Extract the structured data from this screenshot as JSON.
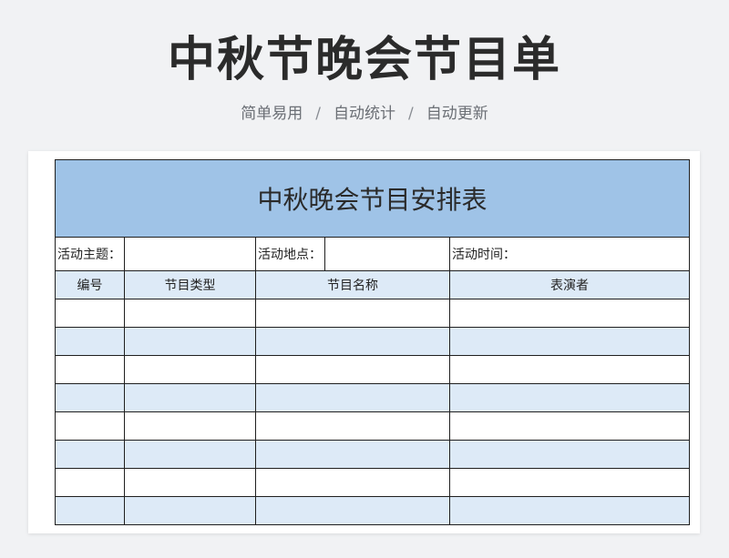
{
  "header": {
    "title": "中秋节晚会节目单",
    "features": [
      "简单易用",
      "自动统计",
      "自动更新"
    ],
    "separator": "/"
  },
  "sheet": {
    "banner_title": "中秋晚会节目安排表",
    "info": {
      "theme_label": "活动主题：",
      "theme_value": "",
      "location_label": "活动地点：",
      "location_value": "",
      "time_label": "活动时间：",
      "time_value": ""
    },
    "columns": [
      "编号",
      "节目类型",
      "节目名称",
      "表演者"
    ],
    "rows": [
      [
        "",
        "",
        "",
        ""
      ],
      [
        "",
        "",
        "",
        ""
      ],
      [
        "",
        "",
        "",
        ""
      ],
      [
        "",
        "",
        "",
        ""
      ],
      [
        "",
        "",
        "",
        ""
      ],
      [
        "",
        "",
        "",
        ""
      ],
      [
        "",
        "",
        "",
        ""
      ],
      [
        "",
        "",
        "",
        ""
      ]
    ]
  },
  "colors": {
    "banner": "#9fc3e7",
    "alt_row": "#ddeaf7",
    "border": "#1f1f1f",
    "background": "#f1f2f4"
  }
}
